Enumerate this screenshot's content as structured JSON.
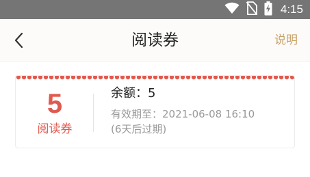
{
  "status_bar": {
    "time": "4:15",
    "icons": [
      "wifi-icon",
      "no-sim-icon",
      "battery-charging-icon"
    ]
  },
  "nav": {
    "title": "阅读券",
    "action_label": "说明",
    "back_icon": "chevron-left-icon"
  },
  "voucher": {
    "count": "5",
    "unit_label": "阅读券",
    "balance_label": "余额：5",
    "expiry_label": "有效期至：2021-06-08 16:10",
    "expiry_note": "(6天后过期)"
  },
  "colors": {
    "status_bar_bg": "#757575",
    "accent_red": "#e05a4e",
    "nav_action": "#c8a064",
    "muted_text": "#999999"
  }
}
